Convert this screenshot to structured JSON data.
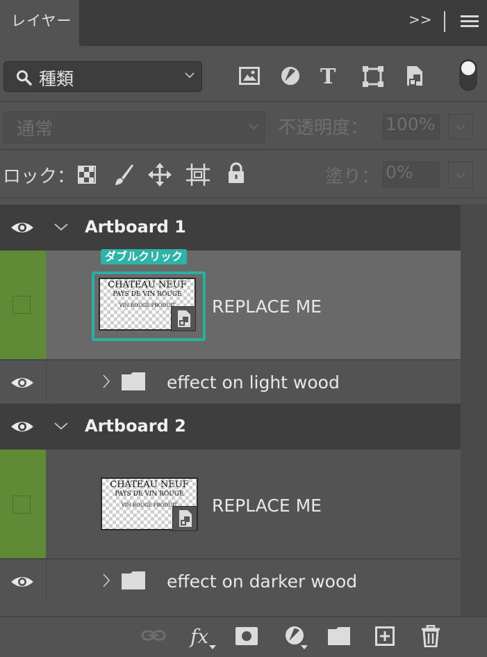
{
  "tab": {
    "title": "レイヤー",
    "collapse": ">>"
  },
  "filter": {
    "kind_value": "種類"
  },
  "blend": {
    "mode_value": "通常",
    "opacity_label": "不透明度：",
    "opacity_value": "100%"
  },
  "lock": {
    "label": "ロック：",
    "fill_label": "塗り：",
    "fill_value": "0%"
  },
  "annotation": "ダブルクリック",
  "thumbnail": {
    "line1": "CHATEAU NEUF",
    "line2": "PAYS DE VIN ROUGE",
    "line3": "VIN ROUGE PRODUIT"
  },
  "artboards": [
    {
      "name": "Artboard 1",
      "smart_layer": "REPLACE ME",
      "group": "effect on light wood"
    },
    {
      "name": "Artboard 2",
      "smart_layer": "REPLACE ME",
      "group": "effect on darker wood"
    }
  ],
  "colors": {
    "accent": "#2ab0a2",
    "artboard_color": "#5f8a36",
    "panel": "#535353",
    "header": "#3e3e3e"
  }
}
